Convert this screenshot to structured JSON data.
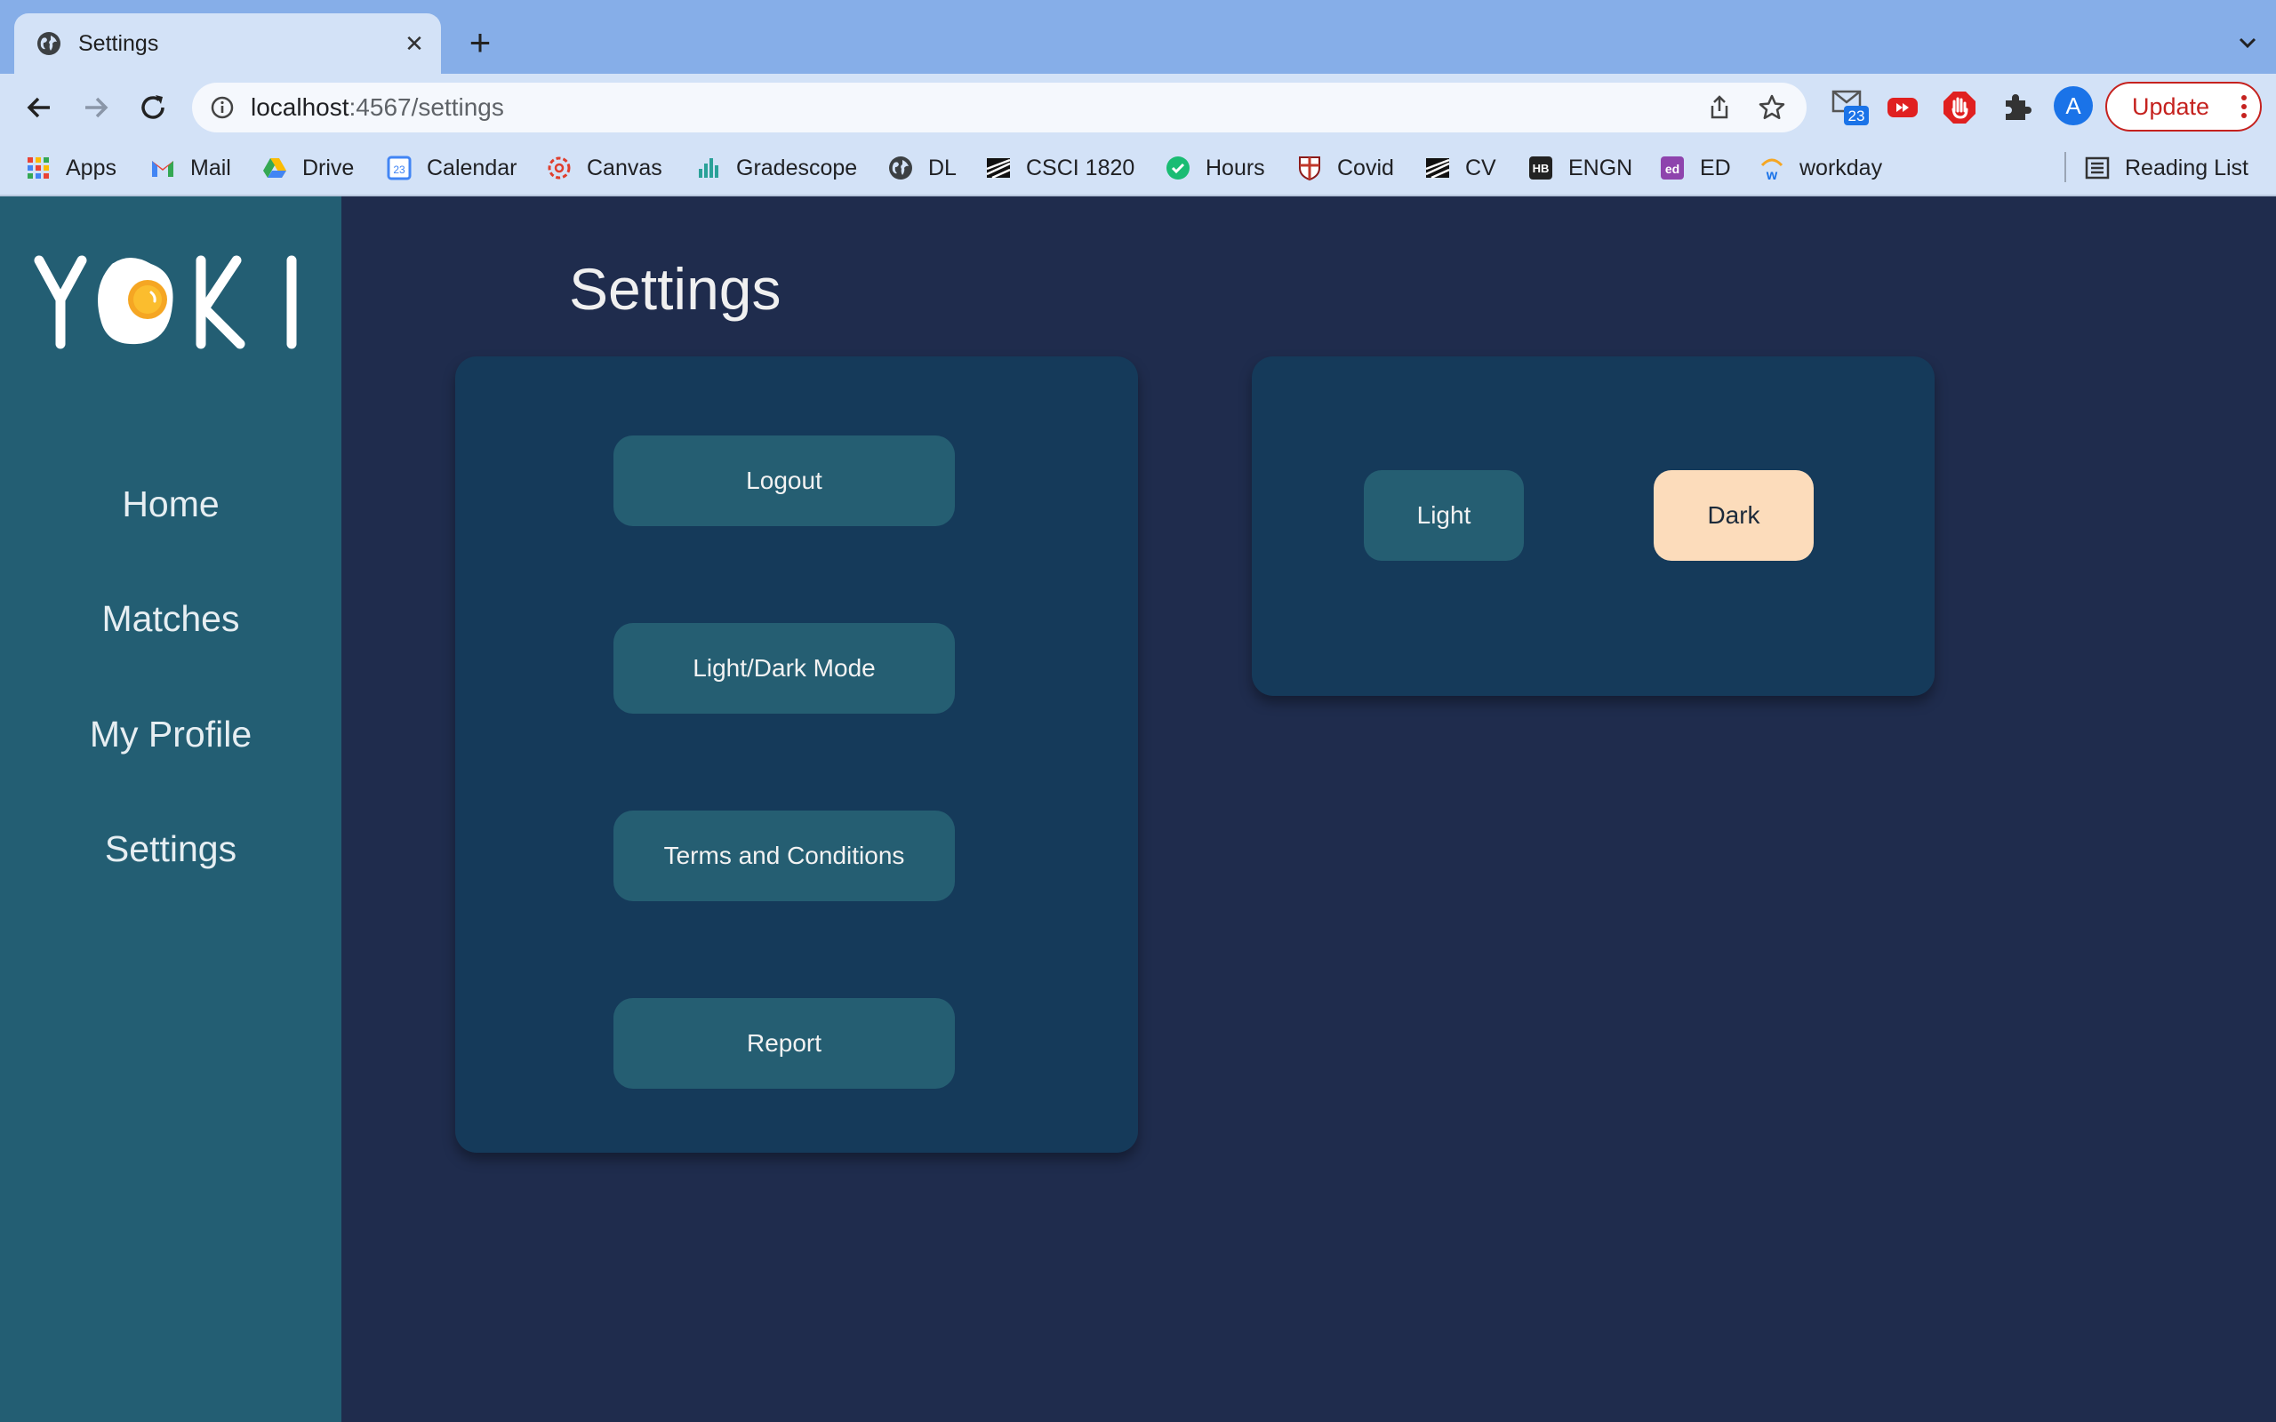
{
  "browser": {
    "tab_title": "Settings",
    "url_host": "localhost",
    "url_rest": ":4567/settings",
    "avatar_letter": "A",
    "update_label": "Update",
    "mail_badge": "23",
    "bookmarks": [
      {
        "label": "Apps",
        "icon": "apps-grid-icon"
      },
      {
        "label": "Mail",
        "icon": "gmail-icon"
      },
      {
        "label": "Drive",
        "icon": "drive-icon"
      },
      {
        "label": "Calendar",
        "icon": "calendar-icon"
      },
      {
        "label": "Canvas",
        "icon": "canvas-icon"
      },
      {
        "label": "Gradescope",
        "icon": "gradescope-icon"
      },
      {
        "label": "DL",
        "icon": "globe-icon"
      },
      {
        "label": "CSCI 1820",
        "icon": "stripes-icon"
      },
      {
        "label": "Hours",
        "icon": "hours-icon"
      },
      {
        "label": "Covid",
        "icon": "shield-crest-icon"
      },
      {
        "label": "CV",
        "icon": "stripes-icon"
      },
      {
        "label": "ENGN",
        "icon": "hb-icon"
      },
      {
        "label": "ED",
        "icon": "ed-icon"
      },
      {
        "label": "workday",
        "icon": "workday-icon"
      }
    ],
    "reading_list": "Reading List",
    "calendar_date": "23"
  },
  "app": {
    "logo_text": "YOKI",
    "nav": [
      "Home",
      "Matches",
      "My Profile",
      "Settings"
    ],
    "page_title": "Settings",
    "menu_buttons": [
      "Logout",
      "Light/Dark Mode",
      "Terms and Conditions",
      "Report"
    ],
    "theme_buttons": {
      "light": "Light",
      "dark": "Dark"
    },
    "selected_theme": "Dark",
    "colors": {
      "sidebar": "#235e73",
      "background": "#1f2c4d",
      "card": "#153a5a",
      "button": "#255e72",
      "selected_button": "#fcdcbb"
    }
  }
}
